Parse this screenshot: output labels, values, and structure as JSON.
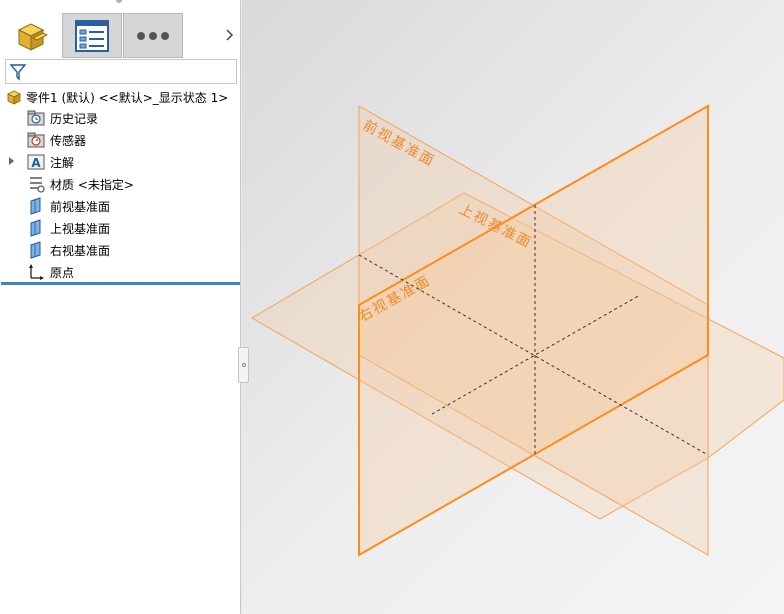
{
  "tabs": [
    {
      "name": "FeatureManager",
      "icon": "part-icon"
    },
    {
      "name": "PropertyManager",
      "icon": "property-list-icon"
    },
    {
      "name": "More",
      "icon": "ellipsis-icon"
    }
  ],
  "filter": {
    "placeholder": "",
    "value": ""
  },
  "tree": {
    "root": "零件1 (默认) <<默认>_显示状态 1>",
    "items": [
      {
        "label": "历史记录",
        "icon": "history-icon"
      },
      {
        "label": "传感器",
        "icon": "sensor-icon"
      },
      {
        "label": "注解",
        "icon": "annotation-icon"
      },
      {
        "label": "材质 <未指定>",
        "icon": "material-icon"
      },
      {
        "label": "前视基准面",
        "icon": "plane-icon"
      },
      {
        "label": "上视基准面",
        "icon": "plane-icon"
      },
      {
        "label": "右视基准面",
        "icon": "plane-icon"
      },
      {
        "label": "原点",
        "icon": "origin-icon"
      }
    ]
  },
  "viewport": {
    "plane_labels": {
      "front": "前视基准面",
      "top": "上视基准面",
      "right": "右视基准面"
    },
    "colors": {
      "plane_edge": "#ff8c1a",
      "plane_fill": "#f6c89a"
    }
  }
}
